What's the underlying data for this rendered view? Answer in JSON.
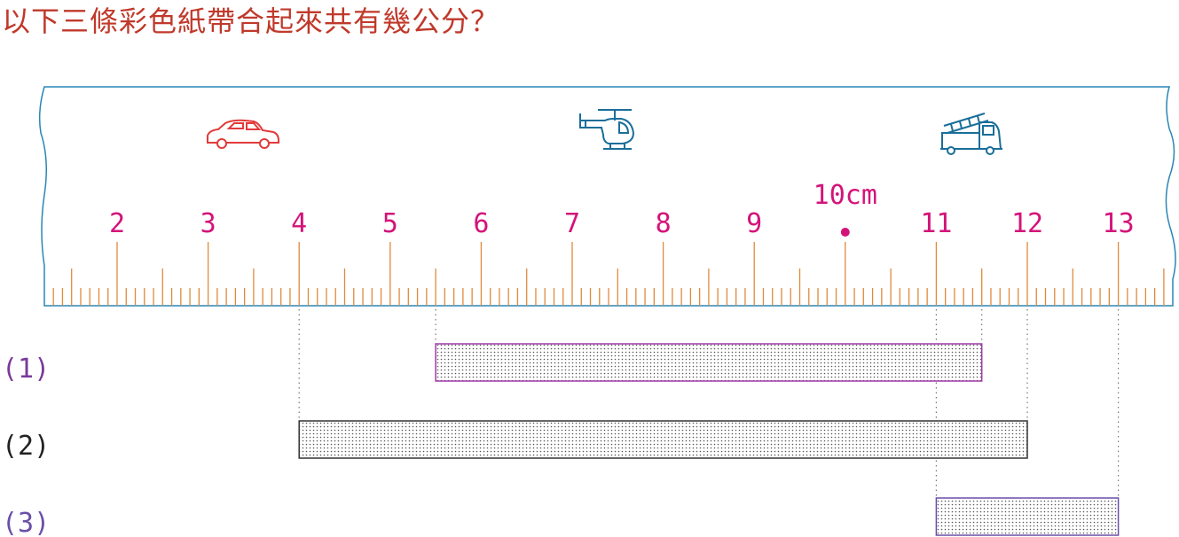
{
  "question": "以下三條彩色紙帶合起來共有幾公分？",
  "ruler": {
    "labels": [
      "2",
      "3",
      "4",
      "5",
      "6",
      "7",
      "8",
      "9",
      "11",
      "12",
      "13"
    ],
    "label_values": [
      2,
      3,
      4,
      5,
      6,
      7,
      8,
      9,
      11,
      12,
      13
    ],
    "highlight_value": 10,
    "highlight_label": "10cm",
    "unit": "cm",
    "icons": [
      "car-icon",
      "helicopter-icon",
      "fire-truck-icon"
    ]
  },
  "strips": [
    {
      "label": "(1)",
      "start": 5.5,
      "end": 11.5,
      "color": "#a03aa8"
    },
    {
      "label": "(2)",
      "start": 4,
      "end": 12,
      "color": "#333333"
    },
    {
      "label": "(3)",
      "start": 11,
      "end": 13,
      "color": "#6a4fa8"
    }
  ],
  "colors": {
    "title": "#c0392b",
    "ruler_border": "#2a86b5",
    "ticks": "#e08a3c",
    "numbers": "#d4137a",
    "car": "#e23a3a",
    "vehicles": "#1a6e9a"
  }
}
